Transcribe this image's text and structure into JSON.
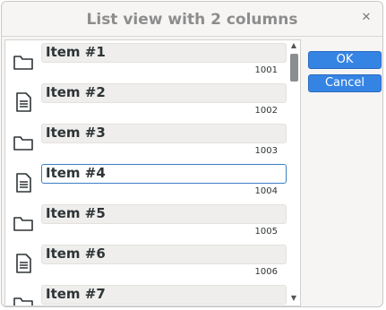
{
  "window": {
    "title": "List view with 2 columns",
    "close_glyph": "✕"
  },
  "list": {
    "items": [
      {
        "name": "Item #1",
        "id": "1001",
        "icon": "folder-icon"
      },
      {
        "name": "Item #2",
        "id": "1002",
        "icon": "document-icon"
      },
      {
        "name": "Item #3",
        "id": "1003",
        "icon": "folder-icon"
      },
      {
        "name": "Item #4",
        "id": "1004",
        "icon": "document-icon",
        "focused": true
      },
      {
        "name": "Item #5",
        "id": "1005",
        "icon": "folder-icon"
      },
      {
        "name": "Item #6",
        "id": "1006",
        "icon": "document-icon"
      },
      {
        "name": "Item #7",
        "id": "",
        "icon": "folder-icon"
      }
    ],
    "scroll_up_glyph": "▲",
    "scroll_down_glyph": "▼"
  },
  "buttons": {
    "ok_label": "OK",
    "cancel_label": "Cancel"
  },
  "colors": {
    "accent": "#3584e4",
    "focus_border": "#3d7ec4"
  }
}
